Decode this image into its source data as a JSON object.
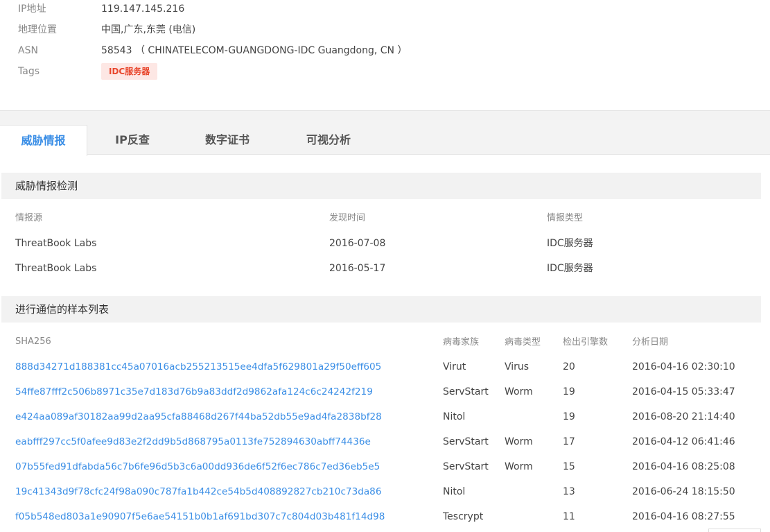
{
  "info": {
    "ip_label": "IP地址",
    "ip_value": "119.147.145.216",
    "geo_label": "地理位置",
    "geo_value": "中国,广东,东莞 (电信)",
    "asn_label": "ASN",
    "asn_value": "58543 （ CHINATELECOM-GUANGDONG-IDC Guangdong, CN ）",
    "tags_label": "Tags",
    "tag": "IDC服务器",
    "tag_color": "#e8462c",
    "tag_bg": "#fde7e4"
  },
  "tabs": [
    {
      "label": "威胁情报",
      "active": true
    },
    {
      "label": "IP反查",
      "active": false
    },
    {
      "label": "数字证书",
      "active": false
    },
    {
      "label": "可视分析",
      "active": false
    }
  ],
  "accent_color": "#3a8ee6",
  "intel": {
    "title": "威胁情报检测",
    "headers": [
      "情报源",
      "发现时间",
      "情报类型"
    ],
    "rows": [
      [
        "ThreatBook Labs",
        "2016-07-08",
        "IDC服务器"
      ],
      [
        "ThreatBook Labs",
        "2016-05-17",
        "IDC服务器"
      ]
    ]
  },
  "samples": {
    "title": "进行通信的样本列表",
    "headers": [
      "SHA256",
      "病毒家族",
      "病毒类型",
      "检出引擎数",
      "分析日期"
    ],
    "rows": [
      [
        "888d34271d188381cc45a07016acb255213515ee4dfa5f629801a29f50eff605",
        "Virut",
        "Virus",
        "20",
        "2016-04-16 02:30:10"
      ],
      [
        "54ffe87fff2c506b8971c35e7d183d76b9a83ddf2d9862afa124c6c24242f219",
        "ServStart",
        "Worm",
        "19",
        "2016-04-15 05:33:47"
      ],
      [
        "e424aa089af30182aa99d2aa95cfa88468d267f44ba52db55e9ad4fa2838bf28",
        "Nitol",
        "",
        "19",
        "2016-08-20 21:14:40"
      ],
      [
        "eabfff297cc5f0afee9d83e2f2dd9b5d868795a0113fe752894630abff74436e",
        "ServStart",
        "Worm",
        "17",
        "2016-04-12 06:41:46"
      ],
      [
        "07b55fed91dfabda56c7b6fe96d5b3c6a00dd936de6f52f6ec786c7ed36eb5e5",
        "ServStart",
        "Worm",
        "15",
        "2016-04-16 08:25:08"
      ],
      [
        "19c41343d9f78cfc24f98a090c787fa1b442ce54b5d408892827cb210c73da86",
        "Nitol",
        "",
        "13",
        "2016-06-24 18:15:50"
      ],
      [
        "f05b548ed803a1e90907f5e6ae54151b0b1af691bd307c7c804d03b481f14d98",
        "Tescrypt",
        "",
        "11",
        "2016-04-16 08:27:55"
      ]
    ]
  }
}
